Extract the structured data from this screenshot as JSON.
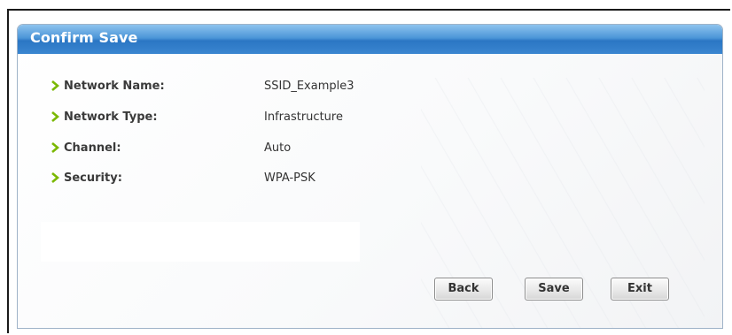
{
  "dialog": {
    "title": "Confirm Save"
  },
  "fields": [
    {
      "label": "Network Name:",
      "value": "SSID_Example3"
    },
    {
      "label": "Network Type:",
      "value": "Infrastructure"
    },
    {
      "label": "Channel:",
      "value": "Auto"
    },
    {
      "label": "Security:",
      "value": "WPA-PSK"
    }
  ],
  "buttons": {
    "back": "Back",
    "save": "Save",
    "exit": "Exit"
  },
  "colors": {
    "title_bar": "#3a86d0",
    "bullet": "#7ab800"
  }
}
